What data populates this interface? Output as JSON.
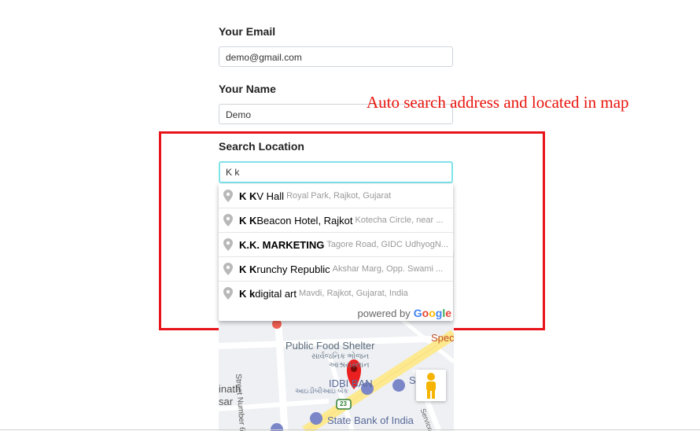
{
  "form": {
    "email_label": "Your Email",
    "email_value": "demo@gmail.com",
    "name_label": "Your Name",
    "name_value": "Demo",
    "location_label": "Search Location",
    "location_value": "K k"
  },
  "annotation": "Auto search address and located in map",
  "suggestions": [
    {
      "match": "K K",
      "rest": " V Hall",
      "secondary": "Royal Park, Rajkot, Gujarat"
    },
    {
      "match": "K K",
      "rest": " Beacon Hotel, Rajkot",
      "secondary": "Kotecha Circle, near ..."
    },
    {
      "match": "K.K. MARKETING",
      "rest": "",
      "secondary": "Tagore Road, GIDC UdhyogN..."
    },
    {
      "match": "K K",
      "rest": "runchy Republic",
      "secondary": "Akshar Marg, Opp. Swami ..."
    },
    {
      "match": "K k",
      "rest": " digital art",
      "secondary": "Mavdi, Rajkot, Gujarat, India"
    }
  ],
  "powered_by": "powered by",
  "google_logo": "Google",
  "map": {
    "labels": {
      "public_food_shelter": "Public Food Shelter",
      "public_food_shelter_gu1": "સાર્વજનિક ભોજન",
      "public_food_shelter_gu2": "આશ્રયસ્થાન",
      "idbi_bank": "IDBI BAN",
      "idbi_bank_gu": "આઇડીબીઆઇ બેંક",
      "street_number_6": "Street Number 6",
      "state_bank": "State Bank of India",
      "spec": "Spec",
      "route_23": "23",
      "inath": "inath",
      "sar": "sar",
      "s_label": "S",
      "service": "Service"
    }
  },
  "colors": {
    "annotation_red": "#e8140c",
    "marker_red": "#ea1f1f",
    "road_yellow": "#fde98f",
    "focus_border": "#7fe3ea"
  }
}
